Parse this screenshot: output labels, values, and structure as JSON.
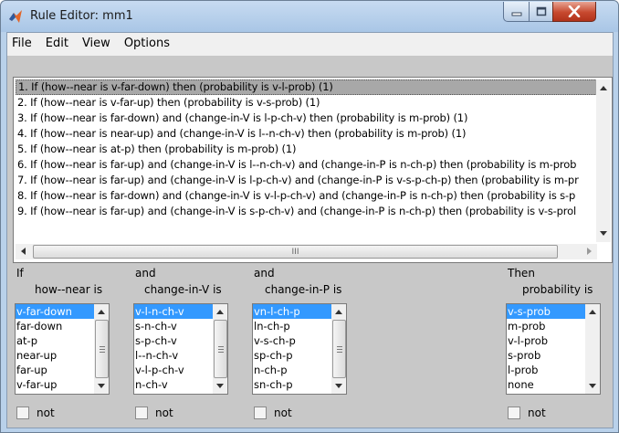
{
  "window": {
    "title": "Rule Editor: mm1"
  },
  "menu": [
    "File",
    "Edit",
    "View",
    "Options"
  ],
  "rules": [
    "1. If (how--near is v-far-down) then (probability is v-l-prob) (1)",
    "2. If (how--near is v-far-up) then (probability is v-s-prob) (1)",
    "3. If (how--near is far-down) and (change-in-V is l-p-ch-v) then (probability is m-prob) (1)",
    "4. If (how--near is near-up) and (change-in-V is l--n-ch-v) then (probability is m-prob) (1)",
    "5. If (how--near is at-p) then (probability is m-prob) (1)",
    "6. If (how--near is far-up) and (change-in-V is l--n-ch-v) and (change-in-P is n-ch-p) then (probability is m-prob",
    "7. If (how--near is far-up) and (change-in-V is l-p-ch-v) and (change-in-P is v-s-p-ch-p) then (probability is m-pr",
    "8. If (how--near is far-down) and (change-in-V is v-l-p-ch-v) and (change-in-P is n-ch-p) then (probability is s-p",
    "9. If (how--near is far-up) and (change-in-V is s-p-ch-v) and (change-in-P is n-ch-p) then (probability is v-s-prol"
  ],
  "hscroll_grip": "III",
  "selected_rule_index": 0,
  "antecedents": [
    {
      "prefix": "If",
      "variable": "how--near is",
      "items": [
        "v-far-down",
        "far-down",
        "at-p",
        "near-up",
        "far-up",
        "v-far-up"
      ],
      "not_label": "not"
    },
    {
      "prefix": "and",
      "variable": "change-in-V is",
      "items": [
        "v-l-n-ch-v",
        "s-n-ch-v",
        "s-p-ch-v",
        "l--n-ch-v",
        "v-l-p-ch-v",
        "n-ch-v"
      ],
      "not_label": "not"
    },
    {
      "prefix": "and",
      "variable": "change-in-P is",
      "items": [
        "vn-l-ch-p",
        "ln-ch-p",
        "v-s-ch-p",
        "sp-ch-p",
        "n-ch-p",
        "sn-ch-p"
      ],
      "not_label": "not"
    }
  ],
  "consequent": {
    "prefix": "Then",
    "variable": "probability is",
    "items": [
      "v-s-prob",
      "m-prob",
      "v-l-prob",
      "s-prob",
      "l-prob",
      "none"
    ],
    "not_label": "not"
  },
  "colors": {
    "selection": "#3399ff",
    "rule_selected": "#a8a8a8",
    "panel": "#c8c8c8",
    "close_button": "#c7492f"
  }
}
